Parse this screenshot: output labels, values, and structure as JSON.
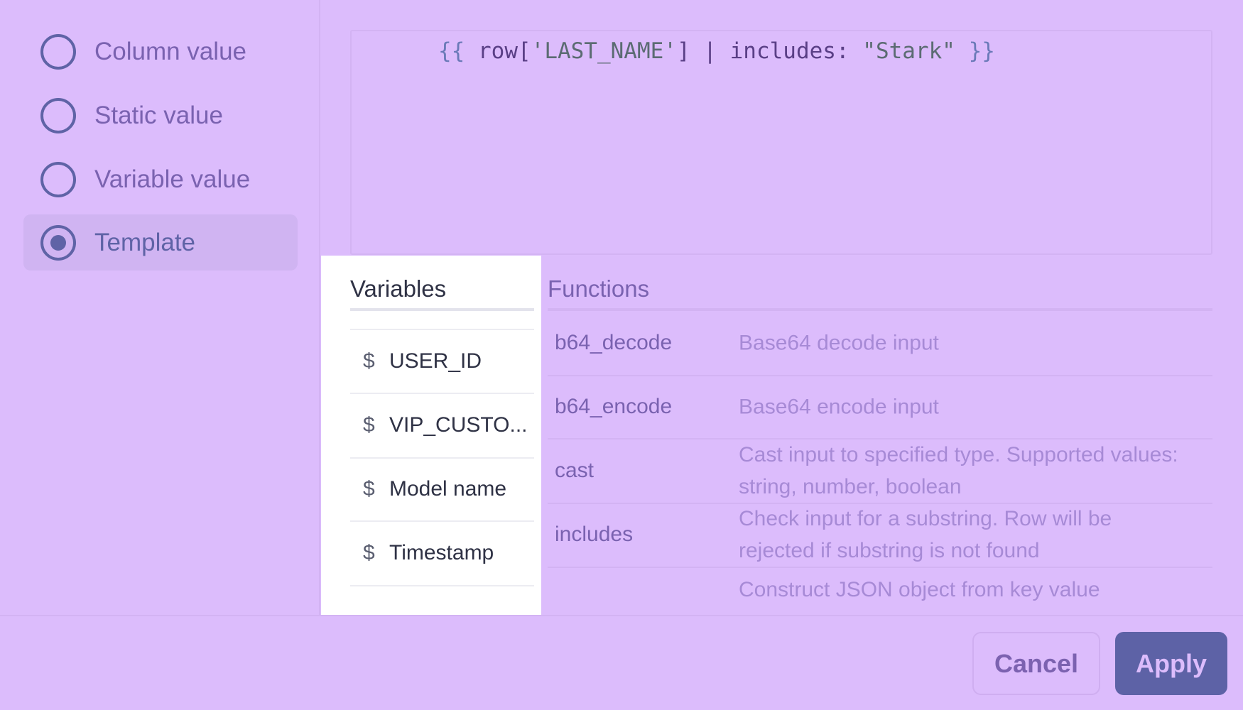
{
  "options": [
    {
      "label": "Column value",
      "selected": false
    },
    {
      "label": "Static value",
      "selected": false
    },
    {
      "label": "Variable value",
      "selected": false
    },
    {
      "label": "Template",
      "selected": true
    }
  ],
  "editor": {
    "open": "{{",
    "row": " row[",
    "key": "'LAST_NAME'",
    "close_bracket": "]",
    "pipe": " | includes: ",
    "arg": "\"Stark\"",
    "close": " }}"
  },
  "variables": {
    "title": "Variables",
    "items": [
      "USER_ID",
      "VIP_CUSTO...",
      "Model name",
      "Timestamp"
    ],
    "symbol": "$"
  },
  "functions": {
    "title": "Functions",
    "items": [
      {
        "name": "b64_decode",
        "desc": "Base64 decode input"
      },
      {
        "name": "b64_encode",
        "desc": "Base64 encode input"
      },
      {
        "name": "cast",
        "desc": "Cast input to specified type. Supported values: string, number, boolean"
      },
      {
        "name": "includes",
        "desc": "Check input for a substring. Row will be rejected if substring is not found"
      },
      {
        "name": "",
        "desc": "Construct JSON object from key value"
      }
    ]
  },
  "footer": {
    "cancel": "Cancel",
    "apply": "Apply"
  },
  "colors": {
    "background": "#dcbcfc",
    "accent": "#5d62a6"
  }
}
